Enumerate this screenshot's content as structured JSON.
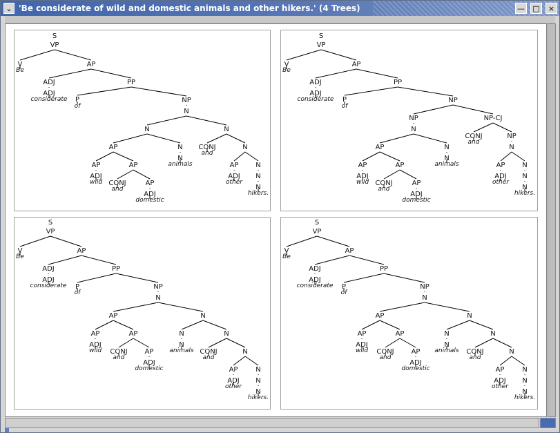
{
  "window": {
    "title": "'Be considerate of wild and domestic animals and other hikers.' (4 Trees)",
    "menu_glyph": "⌄",
    "controls": {
      "minimize": "—",
      "maximize": "□",
      "close": "×"
    }
  },
  "trees": [
    {
      "name": "tree-1",
      "nodes": [
        {
          "label": "S"
        },
        {
          "label": "VP"
        },
        {
          "label": "V"
        },
        {
          "label": "Be",
          "word": true
        },
        {
          "label": "AP"
        },
        {
          "label": "ADJ"
        },
        {
          "label": "ADJ"
        },
        {
          "label": "considerate",
          "word": true
        },
        {
          "label": "PP"
        },
        {
          "label": "P"
        },
        {
          "label": "of",
          "word": true
        },
        {
          "label": "NP"
        },
        {
          "label": "N"
        },
        {
          "label": "N"
        },
        {
          "label": "AP"
        },
        {
          "label": "AP"
        },
        {
          "label": "ADJ"
        },
        {
          "label": "wild",
          "word": true
        },
        {
          "label": "AP"
        },
        {
          "label": "CONJ"
        },
        {
          "label": "and",
          "word": true
        },
        {
          "label": "AP"
        },
        {
          "label": "ADJ"
        },
        {
          "label": "domestic",
          "word": true
        },
        {
          "label": "N"
        },
        {
          "label": "N"
        },
        {
          "label": "animals",
          "word": true
        },
        {
          "label": "N"
        },
        {
          "label": "CONJ"
        },
        {
          "label": "and",
          "word": true
        },
        {
          "label": "N"
        },
        {
          "label": "AP"
        },
        {
          "label": "ADJ"
        },
        {
          "label": "other",
          "word": true
        },
        {
          "label": "N"
        },
        {
          "label": "N"
        },
        {
          "label": "N"
        },
        {
          "label": "hikers.",
          "word": true
        }
      ]
    },
    {
      "name": "tree-2",
      "nodes": [
        {
          "label": "S"
        },
        {
          "label": "VP"
        },
        {
          "label": "V"
        },
        {
          "label": "Be",
          "word": true
        },
        {
          "label": "AP"
        },
        {
          "label": "ADJ"
        },
        {
          "label": "ADJ"
        },
        {
          "label": "considerate",
          "word": true
        },
        {
          "label": "PP"
        },
        {
          "label": "P"
        },
        {
          "label": "of",
          "word": true
        },
        {
          "label": "NP"
        },
        {
          "label": "NP"
        },
        {
          "label": "N"
        },
        {
          "label": "AP"
        },
        {
          "label": "AP"
        },
        {
          "label": "ADJ"
        },
        {
          "label": "wild",
          "word": true
        },
        {
          "label": "AP"
        },
        {
          "label": "CONJ"
        },
        {
          "label": "and",
          "word": true
        },
        {
          "label": "AP"
        },
        {
          "label": "ADJ"
        },
        {
          "label": "domestic",
          "word": true
        },
        {
          "label": "N"
        },
        {
          "label": "N"
        },
        {
          "label": "animals",
          "word": true
        },
        {
          "label": "NP-CJ"
        },
        {
          "label": "CONJ"
        },
        {
          "label": "and",
          "word": true
        },
        {
          "label": "NP"
        },
        {
          "label": "N"
        },
        {
          "label": "AP"
        },
        {
          "label": "ADJ"
        },
        {
          "label": "other",
          "word": true
        },
        {
          "label": "N"
        },
        {
          "label": "N"
        },
        {
          "label": "N"
        },
        {
          "label": "hikers.",
          "word": true
        }
      ]
    },
    {
      "name": "tree-3",
      "nodes": [
        {
          "label": "S"
        },
        {
          "label": "VP"
        },
        {
          "label": "V"
        },
        {
          "label": "Be",
          "word": true
        },
        {
          "label": "AP"
        },
        {
          "label": "ADJ"
        },
        {
          "label": "ADJ"
        },
        {
          "label": "considerate",
          "word": true
        },
        {
          "label": "PP"
        },
        {
          "label": "P"
        },
        {
          "label": "of",
          "word": true
        },
        {
          "label": "NP"
        },
        {
          "label": "N"
        },
        {
          "label": "AP"
        },
        {
          "label": "AP"
        },
        {
          "label": "ADJ"
        },
        {
          "label": "wild",
          "word": true
        },
        {
          "label": "AP"
        },
        {
          "label": "CONJ"
        },
        {
          "label": "and",
          "word": true
        },
        {
          "label": "AP"
        },
        {
          "label": "ADJ"
        },
        {
          "label": "domestic",
          "word": true
        },
        {
          "label": "N"
        },
        {
          "label": "N"
        },
        {
          "label": "N"
        },
        {
          "label": "animals",
          "word": true
        },
        {
          "label": "N"
        },
        {
          "label": "CONJ"
        },
        {
          "label": "and",
          "word": true
        },
        {
          "label": "N"
        },
        {
          "label": "AP"
        },
        {
          "label": "ADJ"
        },
        {
          "label": "other",
          "word": true
        },
        {
          "label": "N"
        },
        {
          "label": "N"
        },
        {
          "label": "N"
        },
        {
          "label": "hikers.",
          "word": true
        }
      ]
    },
    {
      "name": "tree-4",
      "nodes": [
        {
          "label": "S"
        },
        {
          "label": "VP"
        },
        {
          "label": "V"
        },
        {
          "label": "Be",
          "word": true
        },
        {
          "label": "AP"
        },
        {
          "label": "ADJ"
        },
        {
          "label": "ADJ"
        },
        {
          "label": "considerate",
          "word": true
        },
        {
          "label": "PP"
        },
        {
          "label": "P"
        },
        {
          "label": "of",
          "word": true
        },
        {
          "label": "NP"
        },
        {
          "label": "N"
        },
        {
          "label": "AP"
        },
        {
          "label": "AP"
        },
        {
          "label": "ADJ"
        },
        {
          "label": "wild",
          "word": true
        },
        {
          "label": "AP"
        },
        {
          "label": "CONJ"
        },
        {
          "label": "and",
          "word": true
        },
        {
          "label": "AP"
        },
        {
          "label": "ADJ"
        },
        {
          "label": "domestic",
          "word": true
        },
        {
          "label": "N"
        },
        {
          "label": "N"
        },
        {
          "label": "N"
        },
        {
          "label": "animals",
          "word": true
        },
        {
          "label": "N"
        },
        {
          "label": "CONJ"
        },
        {
          "label": "and",
          "word": true
        },
        {
          "label": "N"
        },
        {
          "label": "AP"
        },
        {
          "label": "ADJ"
        },
        {
          "label": "other",
          "word": true
        },
        {
          "label": "N"
        },
        {
          "label": "N"
        },
        {
          "label": "N"
        },
        {
          "label": "hikers.",
          "word": true
        }
      ]
    }
  ]
}
